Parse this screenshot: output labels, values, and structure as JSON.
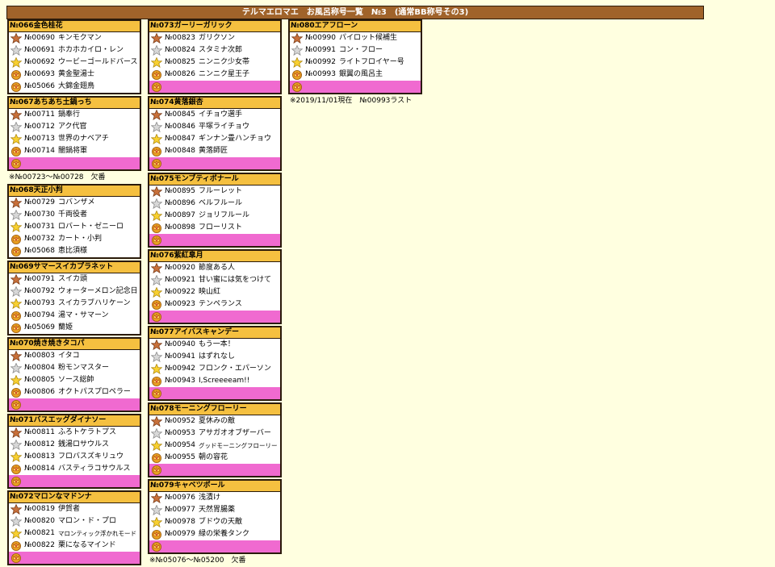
{
  "title": "テルマエロマエ　お風呂称号一覧　№3　(通常BB称号その3)",
  "columns": [
    {
      "blocks": [
        {
          "type": "group",
          "title": "№066金色桂花",
          "rows": [
            {
              "badge": "bronze",
              "num": "№00690",
              "name": "キンモクマン"
            },
            {
              "badge": "silver",
              "num": "№00691",
              "name": "ホカホカイロ・レン"
            },
            {
              "badge": "gold",
              "num": "№00692",
              "name": "ウービーゴールドバース"
            },
            {
              "badge": "crown",
              "num": "№00693",
              "name": "黄金聖湯士"
            },
            {
              "badge": "crown",
              "num": "№05066",
              "name": "大錦金翅鳥"
            }
          ]
        },
        {
          "type": "group",
          "title": "№067あちあち土鍋っち",
          "rows": [
            {
              "badge": "bronze",
              "num": "№00711",
              "name": "鍋奉行"
            },
            {
              "badge": "silver",
              "num": "№00712",
              "name": "アク代官"
            },
            {
              "badge": "gold",
              "num": "№00713",
              "name": "世界のナベアチ"
            },
            {
              "badge": "crown",
              "num": "№00714",
              "name": "闇鍋将軍"
            },
            {
              "badge": "crown",
              "pink": true
            }
          ]
        },
        {
          "type": "note",
          "text": "※№00723～№00728　欠番"
        },
        {
          "type": "group",
          "title": "№068天正小判",
          "rows": [
            {
              "badge": "bronze",
              "num": "№00729",
              "name": "コバンザメ"
            },
            {
              "badge": "silver",
              "num": "№00730",
              "name": "千両役者"
            },
            {
              "badge": "gold",
              "num": "№00731",
              "name": "ロバート・ゼニーロ"
            },
            {
              "badge": "crown",
              "num": "№00732",
              "name": "カート・小判"
            },
            {
              "badge": "crown",
              "num": "№05068",
              "name": "恵比須様"
            }
          ]
        },
        {
          "type": "group",
          "title": "№069サマースイカプラネット",
          "rows": [
            {
              "badge": "bronze",
              "num": "№00791",
              "name": "スイカ頭"
            },
            {
              "badge": "silver",
              "num": "№00792",
              "name": "ウォーターメロン記念日"
            },
            {
              "badge": "gold",
              "num": "№00793",
              "name": "スイカラブハリケーン"
            },
            {
              "badge": "crown",
              "num": "№00794",
              "name": "湯マ・サマーン"
            },
            {
              "badge": "crown",
              "num": "№05069",
              "name": "蘭姫"
            }
          ]
        },
        {
          "type": "group",
          "title": "№070焼き焼きタコパ",
          "rows": [
            {
              "badge": "bronze",
              "num": "№00803",
              "name": "イタコ"
            },
            {
              "badge": "silver",
              "num": "№00804",
              "name": "粉モンマスター"
            },
            {
              "badge": "gold",
              "num": "№00805",
              "name": "ソース総帥"
            },
            {
              "badge": "crown",
              "num": "№00806",
              "name": "オクトパスプロペラー"
            },
            {
              "badge": "crown",
              "pink": true
            }
          ]
        },
        {
          "type": "group",
          "title": "№071バスエッグダイナソー",
          "rows": [
            {
              "badge": "bronze",
              "num": "№00811",
              "name": "ふろトケラトプス"
            },
            {
              "badge": "silver",
              "num": "№00812",
              "name": "銭湯ロサウルス"
            },
            {
              "badge": "gold",
              "num": "№00813",
              "name": "フロバスズキリュウ"
            },
            {
              "badge": "crown",
              "num": "№00814",
              "name": "バスティラコサウルス"
            },
            {
              "badge": "crown",
              "pink": true
            }
          ]
        },
        {
          "type": "group",
          "title": "№072マロンなマドンナ",
          "rows": [
            {
              "badge": "bronze",
              "num": "№00819",
              "name": "伊賀者"
            },
            {
              "badge": "silver",
              "num": "№00820",
              "name": "マロン・ド・プロ"
            },
            {
              "badge": "gold",
              "num": "№00821",
              "name": "マロンティック浮かれモード",
              "small": true
            },
            {
              "badge": "crown",
              "num": "№00822",
              "name": "栗になるマインド"
            },
            {
              "badge": "crown",
              "pink": true
            }
          ]
        }
      ]
    },
    {
      "blocks": [
        {
          "type": "group",
          "title": "№073ガーリーガリック",
          "rows": [
            {
              "badge": "bronze",
              "num": "№00823",
              "name": "ガリクソン"
            },
            {
              "badge": "silver",
              "num": "№00824",
              "name": "スタミナ次郎"
            },
            {
              "badge": "gold",
              "num": "№00825",
              "name": "ニンニク少女帯"
            },
            {
              "badge": "crown",
              "num": "№00826",
              "name": "ニンニク星王子"
            },
            {
              "badge": "crown",
              "pink": true
            }
          ]
        },
        {
          "type": "group",
          "title": "№074黄落銀杏",
          "rows": [
            {
              "badge": "bronze",
              "num": "№00845",
              "name": "イチョウ選手"
            },
            {
              "badge": "silver",
              "num": "№00846",
              "name": "平塚ライチョウ"
            },
            {
              "badge": "gold",
              "num": "№00847",
              "name": "ギンナン畳ハンチョウ"
            },
            {
              "badge": "crown",
              "num": "№00848",
              "name": "黄落師匠"
            },
            {
              "badge": "crown",
              "pink": true
            }
          ]
        },
        {
          "type": "group",
          "title": "№075モンブティボナール",
          "rows": [
            {
              "badge": "bronze",
              "num": "№00895",
              "name": "フルーレット"
            },
            {
              "badge": "silver",
              "num": "№00896",
              "name": "ベルフルール"
            },
            {
              "badge": "gold",
              "num": "№00897",
              "name": "ジョリフルール"
            },
            {
              "badge": "crown",
              "num": "№00898",
              "name": "フローリスト"
            },
            {
              "badge": "crown",
              "pink": true
            }
          ]
        },
        {
          "type": "group",
          "title": "№076紫紅皐月",
          "rows": [
            {
              "badge": "bronze",
              "num": "№00920",
              "name": "節度ある人"
            },
            {
              "badge": "silver",
              "num": "№00921",
              "name": "甘い蜜には気をつけて"
            },
            {
              "badge": "gold",
              "num": "№00922",
              "name": "映山紅"
            },
            {
              "badge": "crown",
              "num": "№00923",
              "name": "テンペランス"
            },
            {
              "badge": "crown",
              "pink": true
            }
          ]
        },
        {
          "type": "group",
          "title": "№077アイバスキャンデー",
          "rows": [
            {
              "badge": "bronze",
              "num": "№00940",
              "name": "もう一本！"
            },
            {
              "badge": "silver",
              "num": "№00941",
              "name": "はずれなし"
            },
            {
              "badge": "gold",
              "num": "№00942",
              "name": "フロンク・エパーソン"
            },
            {
              "badge": "crown",
              "num": "№00943",
              "name": "I,Screeeeam!!"
            },
            {
              "badge": "crown",
              "pink": true
            }
          ]
        },
        {
          "type": "group",
          "title": "№078モーニングフローリー",
          "rows": [
            {
              "badge": "bronze",
              "num": "№00952",
              "name": "夏休みの敵"
            },
            {
              "badge": "silver",
              "num": "№00953",
              "name": "アサガオオブザーバー"
            },
            {
              "badge": "gold",
              "num": "№00954",
              "name": "グッドモーニングフローリー",
              "small": true
            },
            {
              "badge": "crown",
              "num": "№00955",
              "name": "朝の容花"
            },
            {
              "badge": "crown",
              "pink": true
            }
          ]
        },
        {
          "type": "group",
          "title": "№079キャベツボール",
          "rows": [
            {
              "badge": "bronze",
              "num": "№00976",
              "name": "浅漬け"
            },
            {
              "badge": "silver",
              "num": "№00977",
              "name": "天然胃腸薬"
            },
            {
              "badge": "gold",
              "num": "№00978",
              "name": "ブドウの天敵"
            },
            {
              "badge": "crown",
              "num": "№00979",
              "name": "緑の栄養タンク"
            },
            {
              "badge": "crown",
              "pink": true
            }
          ]
        },
        {
          "type": "note",
          "text": "※№05076～№05200　欠番"
        }
      ]
    },
    {
      "blocks": [
        {
          "type": "group",
          "title": "№080エアフローン",
          "rows": [
            {
              "badge": "bronze",
              "num": "№00990",
              "name": "パイロット候補生"
            },
            {
              "badge": "silver",
              "num": "№00991",
              "name": "コン・フロー"
            },
            {
              "badge": "gold",
              "num": "№00992",
              "name": "ライトフロイヤー号"
            },
            {
              "badge": "crown",
              "num": "№00993",
              "name": "銀翼の風呂主"
            },
            {
              "badge": "crown",
              "pink": true
            }
          ]
        },
        {
          "type": "note",
          "text": "※2019/11/01現在　№00993ラスト"
        }
      ]
    }
  ],
  "colors": {
    "title_bg": "#a0632a",
    "group_head": "#f5c040",
    "pink_row": "#f06ad0",
    "page_bg": "#ffffe0"
  },
  "badge_icons": {
    "bronze": "bronze-star-icon",
    "silver": "silver-star-icon",
    "gold": "gold-star-icon",
    "crown": "crown-badge-icon"
  }
}
